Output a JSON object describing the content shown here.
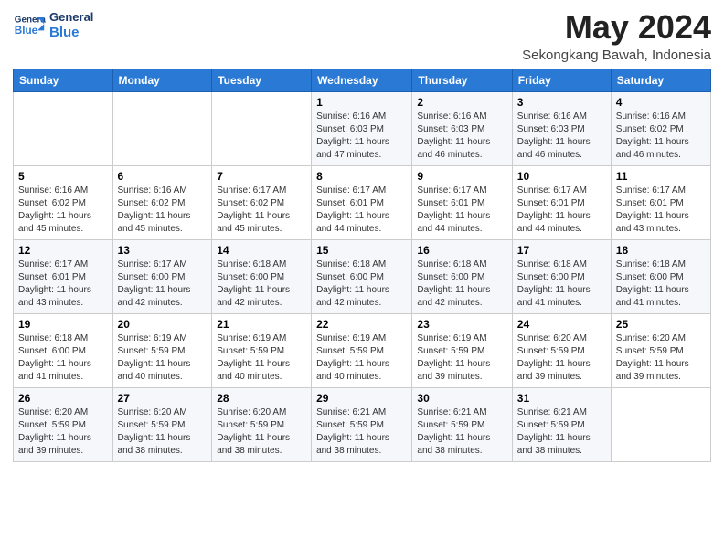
{
  "logo": {
    "general": "General",
    "blue": "Blue"
  },
  "header": {
    "month": "May 2024",
    "location": "Sekongkang Bawah, Indonesia"
  },
  "days_of_week": [
    "Sunday",
    "Monday",
    "Tuesday",
    "Wednesday",
    "Thursday",
    "Friday",
    "Saturday"
  ],
  "weeks": [
    [
      {
        "day": "",
        "info": ""
      },
      {
        "day": "",
        "info": ""
      },
      {
        "day": "",
        "info": ""
      },
      {
        "day": "1",
        "info": "Sunrise: 6:16 AM\nSunset: 6:03 PM\nDaylight: 11 hours\nand 47 minutes."
      },
      {
        "day": "2",
        "info": "Sunrise: 6:16 AM\nSunset: 6:03 PM\nDaylight: 11 hours\nand 46 minutes."
      },
      {
        "day": "3",
        "info": "Sunrise: 6:16 AM\nSunset: 6:03 PM\nDaylight: 11 hours\nand 46 minutes."
      },
      {
        "day": "4",
        "info": "Sunrise: 6:16 AM\nSunset: 6:02 PM\nDaylight: 11 hours\nand 46 minutes."
      }
    ],
    [
      {
        "day": "5",
        "info": "Sunrise: 6:16 AM\nSunset: 6:02 PM\nDaylight: 11 hours\nand 45 minutes."
      },
      {
        "day": "6",
        "info": "Sunrise: 6:16 AM\nSunset: 6:02 PM\nDaylight: 11 hours\nand 45 minutes."
      },
      {
        "day": "7",
        "info": "Sunrise: 6:17 AM\nSunset: 6:02 PM\nDaylight: 11 hours\nand 45 minutes."
      },
      {
        "day": "8",
        "info": "Sunrise: 6:17 AM\nSunset: 6:01 PM\nDaylight: 11 hours\nand 44 minutes."
      },
      {
        "day": "9",
        "info": "Sunrise: 6:17 AM\nSunset: 6:01 PM\nDaylight: 11 hours\nand 44 minutes."
      },
      {
        "day": "10",
        "info": "Sunrise: 6:17 AM\nSunset: 6:01 PM\nDaylight: 11 hours\nand 44 minutes."
      },
      {
        "day": "11",
        "info": "Sunrise: 6:17 AM\nSunset: 6:01 PM\nDaylight: 11 hours\nand 43 minutes."
      }
    ],
    [
      {
        "day": "12",
        "info": "Sunrise: 6:17 AM\nSunset: 6:01 PM\nDaylight: 11 hours\nand 43 minutes."
      },
      {
        "day": "13",
        "info": "Sunrise: 6:17 AM\nSunset: 6:00 PM\nDaylight: 11 hours\nand 42 minutes."
      },
      {
        "day": "14",
        "info": "Sunrise: 6:18 AM\nSunset: 6:00 PM\nDaylight: 11 hours\nand 42 minutes."
      },
      {
        "day": "15",
        "info": "Sunrise: 6:18 AM\nSunset: 6:00 PM\nDaylight: 11 hours\nand 42 minutes."
      },
      {
        "day": "16",
        "info": "Sunrise: 6:18 AM\nSunset: 6:00 PM\nDaylight: 11 hours\nand 42 minutes."
      },
      {
        "day": "17",
        "info": "Sunrise: 6:18 AM\nSunset: 6:00 PM\nDaylight: 11 hours\nand 41 minutes."
      },
      {
        "day": "18",
        "info": "Sunrise: 6:18 AM\nSunset: 6:00 PM\nDaylight: 11 hours\nand 41 minutes."
      }
    ],
    [
      {
        "day": "19",
        "info": "Sunrise: 6:18 AM\nSunset: 6:00 PM\nDaylight: 11 hours\nand 41 minutes."
      },
      {
        "day": "20",
        "info": "Sunrise: 6:19 AM\nSunset: 5:59 PM\nDaylight: 11 hours\nand 40 minutes."
      },
      {
        "day": "21",
        "info": "Sunrise: 6:19 AM\nSunset: 5:59 PM\nDaylight: 11 hours\nand 40 minutes."
      },
      {
        "day": "22",
        "info": "Sunrise: 6:19 AM\nSunset: 5:59 PM\nDaylight: 11 hours\nand 40 minutes."
      },
      {
        "day": "23",
        "info": "Sunrise: 6:19 AM\nSunset: 5:59 PM\nDaylight: 11 hours\nand 39 minutes."
      },
      {
        "day": "24",
        "info": "Sunrise: 6:20 AM\nSunset: 5:59 PM\nDaylight: 11 hours\nand 39 minutes."
      },
      {
        "day": "25",
        "info": "Sunrise: 6:20 AM\nSunset: 5:59 PM\nDaylight: 11 hours\nand 39 minutes."
      }
    ],
    [
      {
        "day": "26",
        "info": "Sunrise: 6:20 AM\nSunset: 5:59 PM\nDaylight: 11 hours\nand 39 minutes."
      },
      {
        "day": "27",
        "info": "Sunrise: 6:20 AM\nSunset: 5:59 PM\nDaylight: 11 hours\nand 38 minutes."
      },
      {
        "day": "28",
        "info": "Sunrise: 6:20 AM\nSunset: 5:59 PM\nDaylight: 11 hours\nand 38 minutes."
      },
      {
        "day": "29",
        "info": "Sunrise: 6:21 AM\nSunset: 5:59 PM\nDaylight: 11 hours\nand 38 minutes."
      },
      {
        "day": "30",
        "info": "Sunrise: 6:21 AM\nSunset: 5:59 PM\nDaylight: 11 hours\nand 38 minutes."
      },
      {
        "day": "31",
        "info": "Sunrise: 6:21 AM\nSunset: 5:59 PM\nDaylight: 11 hours\nand 38 minutes."
      },
      {
        "day": "",
        "info": ""
      }
    ]
  ]
}
